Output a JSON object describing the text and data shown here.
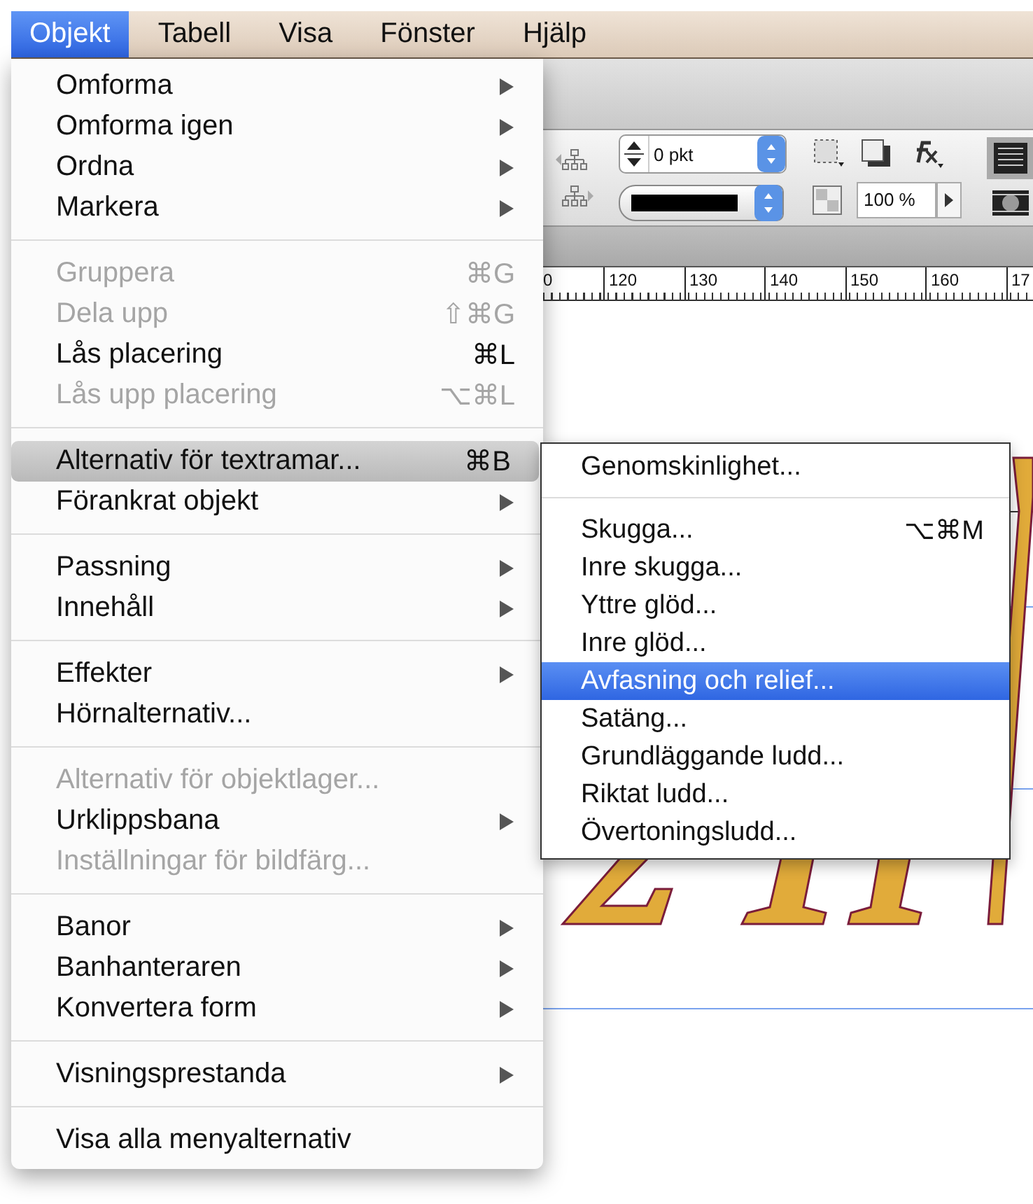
{
  "menubar": [
    {
      "label": "Objekt",
      "selected": true
    },
    {
      "label": "Tabell",
      "selected": false
    },
    {
      "label": "Visa",
      "selected": false
    },
    {
      "label": "Fönster",
      "selected": false
    },
    {
      "label": "Hjälp",
      "selected": false
    }
  ],
  "toolbar": {
    "stroke_weight": "0 pkt",
    "opacity": "100 %"
  },
  "ruler": {
    "labels": [
      "0",
      "120",
      "130",
      "140",
      "150",
      "160",
      "17"
    ]
  },
  "menu": {
    "sections": [
      [
        {
          "label": "Omforma",
          "submenu": true,
          "disabled": false,
          "selected": false
        },
        {
          "label": "Omforma igen",
          "submenu": true,
          "disabled": false,
          "selected": false
        },
        {
          "label": "Ordna",
          "submenu": true,
          "disabled": false,
          "selected": false
        },
        {
          "label": "Markera",
          "submenu": true,
          "disabled": false,
          "selected": false
        }
      ],
      [
        {
          "label": "Gruppera",
          "shortcut": "⌘G",
          "submenu": false,
          "disabled": true,
          "selected": false
        },
        {
          "label": "Dela upp",
          "shortcut": "⇧⌘G",
          "submenu": false,
          "disabled": true,
          "selected": false
        },
        {
          "label": "Lås placering",
          "shortcut": "⌘L",
          "submenu": false,
          "disabled": false,
          "selected": false
        },
        {
          "label": "Lås upp placering",
          "shortcut": "⌥⌘L",
          "submenu": false,
          "disabled": true,
          "selected": false
        }
      ],
      [
        {
          "label": "Alternativ för textramar...",
          "shortcut": "⌘B",
          "submenu": false,
          "disabled": false,
          "selected": true
        },
        {
          "label": "Förankrat objekt",
          "submenu": true,
          "disabled": false,
          "selected": false
        }
      ],
      [
        {
          "label": "Passning",
          "submenu": true,
          "disabled": false,
          "selected": false
        },
        {
          "label": "Innehåll",
          "submenu": true,
          "disabled": false,
          "selected": false
        }
      ],
      [
        {
          "label": "Effekter",
          "submenu": true,
          "disabled": false,
          "selected": false
        },
        {
          "label": "Hörnalternativ...",
          "submenu": false,
          "disabled": false,
          "selected": false
        }
      ],
      [
        {
          "label": "Alternativ för objektlager...",
          "submenu": false,
          "disabled": true,
          "selected": false
        },
        {
          "label": "Urklippsbana",
          "submenu": true,
          "disabled": false,
          "selected": false
        },
        {
          "label": "Inställningar för bildfärg...",
          "submenu": false,
          "disabled": true,
          "selected": false
        }
      ],
      [
        {
          "label": "Banor",
          "submenu": true,
          "disabled": false,
          "selected": false
        },
        {
          "label": "Banhanteraren",
          "submenu": true,
          "disabled": false,
          "selected": false
        },
        {
          "label": "Konvertera form",
          "submenu": true,
          "disabled": false,
          "selected": false
        }
      ],
      [
        {
          "label": "Visningsprestanda",
          "submenu": true,
          "disabled": false,
          "selected": false
        }
      ],
      [
        {
          "label": "Visa alla menyalternativ",
          "submenu": false,
          "disabled": false,
          "selected": false
        }
      ]
    ]
  },
  "submenu": {
    "sections": [
      [
        {
          "label": "Genomskinlighet...",
          "selected": false
        }
      ],
      [
        {
          "label": "Skugga...",
          "shortcut": "⌥⌘M",
          "selected": false
        },
        {
          "label": "Inre skugga...",
          "selected": false
        },
        {
          "label": "Yttre glöd...",
          "selected": false
        },
        {
          "label": "Inre glöd...",
          "selected": false
        },
        {
          "label": "Avfasning och relief...",
          "selected": true
        },
        {
          "label": "Satäng...",
          "selected": false
        },
        {
          "label": "Grundläggande ludd...",
          "selected": false
        },
        {
          "label": "Riktat ludd...",
          "selected": false
        },
        {
          "label": "Övertoningsludd...",
          "selected": false
        }
      ]
    ]
  }
}
